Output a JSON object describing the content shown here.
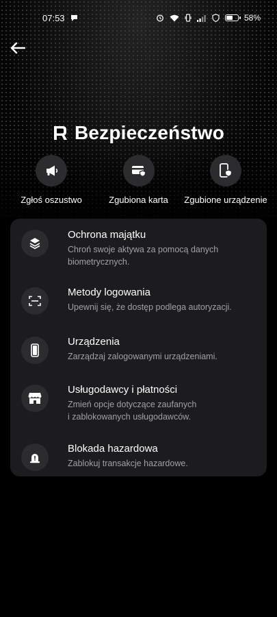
{
  "status_bar": {
    "time": "07:53",
    "battery_percent": "58%",
    "battery_level": 0.58,
    "icons": [
      "notification-icon",
      "alarm-icon",
      "wifi-icon",
      "vibrate-icon",
      "signal-icon",
      "shield-icon",
      "battery-icon"
    ]
  },
  "header": {
    "back_icon": "arrow-left-icon",
    "title": "Bezpieczeństwo",
    "logo_icon": "revolut-logo-icon"
  },
  "quick_actions": [
    {
      "label": "Zgłoś oszustwo",
      "icon": "megaphone-icon"
    },
    {
      "label": "Zgubiona karta",
      "icon": "card-shield-icon"
    },
    {
      "label": "Zgubione urządzenie",
      "icon": "phone-shield-icon"
    }
  ],
  "menu": [
    {
      "title": "Ochrona majątku",
      "desc1": "Chroń swoje aktywa za pomocą danych",
      "desc2": "biometrycznych.",
      "icon": "layers-icon"
    },
    {
      "title": "Metody logowania",
      "desc1": "Upewnij się, że dostęp podlega autoryzacji.",
      "desc2": "",
      "icon": "scan-icon"
    },
    {
      "title": "Urządzenia",
      "desc1": "Zarządzaj zalogowanymi urządzeniami.",
      "desc2": "",
      "icon": "phone-icon"
    },
    {
      "title": "Usługodawcy i płatności",
      "desc1": "Zmień opcje dotyczące zaufanych",
      "desc2": "i zablokowanych usługodawców.",
      "icon": "store-icon"
    },
    {
      "title": "Blokada hazardowa",
      "desc1": "Zablokuj transakcje hazardowe.",
      "desc2": "",
      "icon": "alert-siren-icon"
    }
  ]
}
